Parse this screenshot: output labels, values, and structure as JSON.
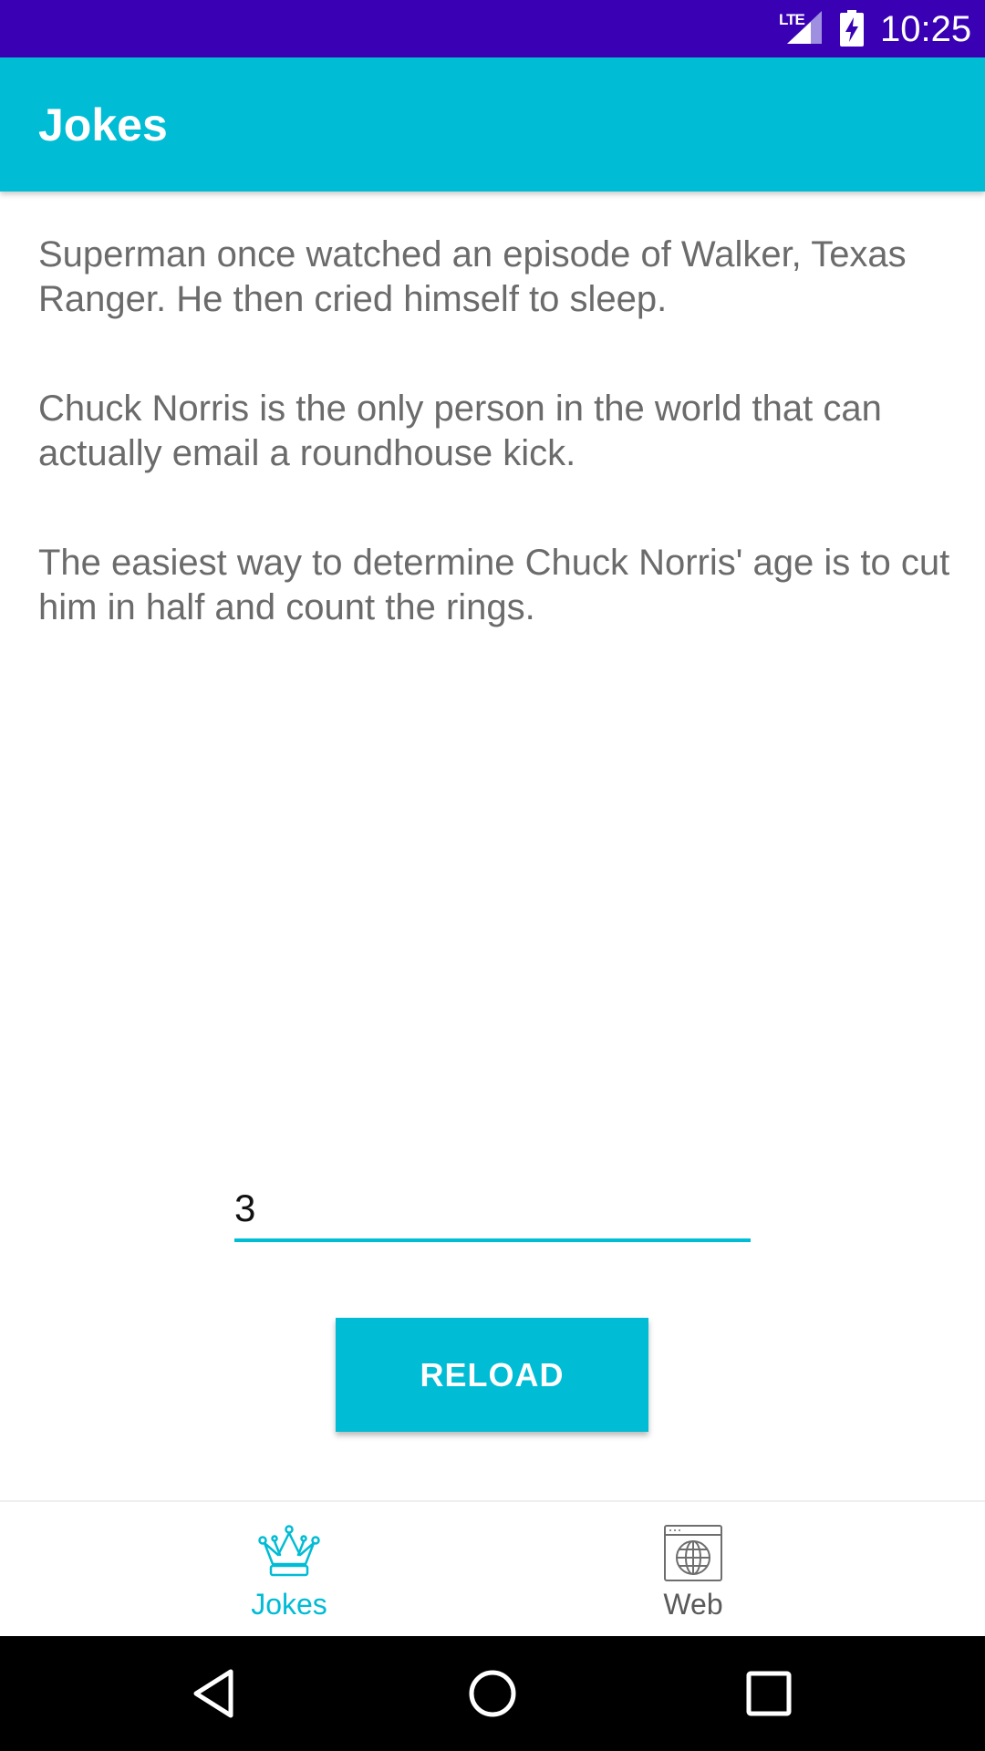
{
  "status_bar": {
    "network_label": "LTE",
    "time": "10:25",
    "colors": {
      "background": "#3a00b4",
      "foreground": "#ffffff"
    }
  },
  "app_bar": {
    "title": "Jokes",
    "color": "#00bcd4"
  },
  "jokes": [
    "Superman once watched an episode of Walker, Texas Ranger. He then cried himself to sleep.",
    "Chuck Norris is the only person in the world that can actually email a roundhouse kick.",
    "The easiest way to determine Chuck Norris' age is to cut him in half and count the rings."
  ],
  "count_input": {
    "value": "3"
  },
  "reload_button": {
    "label": "RELOAD"
  },
  "bottom_nav": {
    "items": [
      {
        "label": "Jokes",
        "icon": "crown-icon",
        "selected": true
      },
      {
        "label": "Web",
        "icon": "web-browser-icon",
        "selected": false
      }
    ],
    "active_color": "#00bcd4",
    "inactive_color": "#5a5a5a"
  },
  "system_nav": {
    "buttons": [
      "back-icon",
      "home-icon",
      "recents-icon"
    ]
  }
}
